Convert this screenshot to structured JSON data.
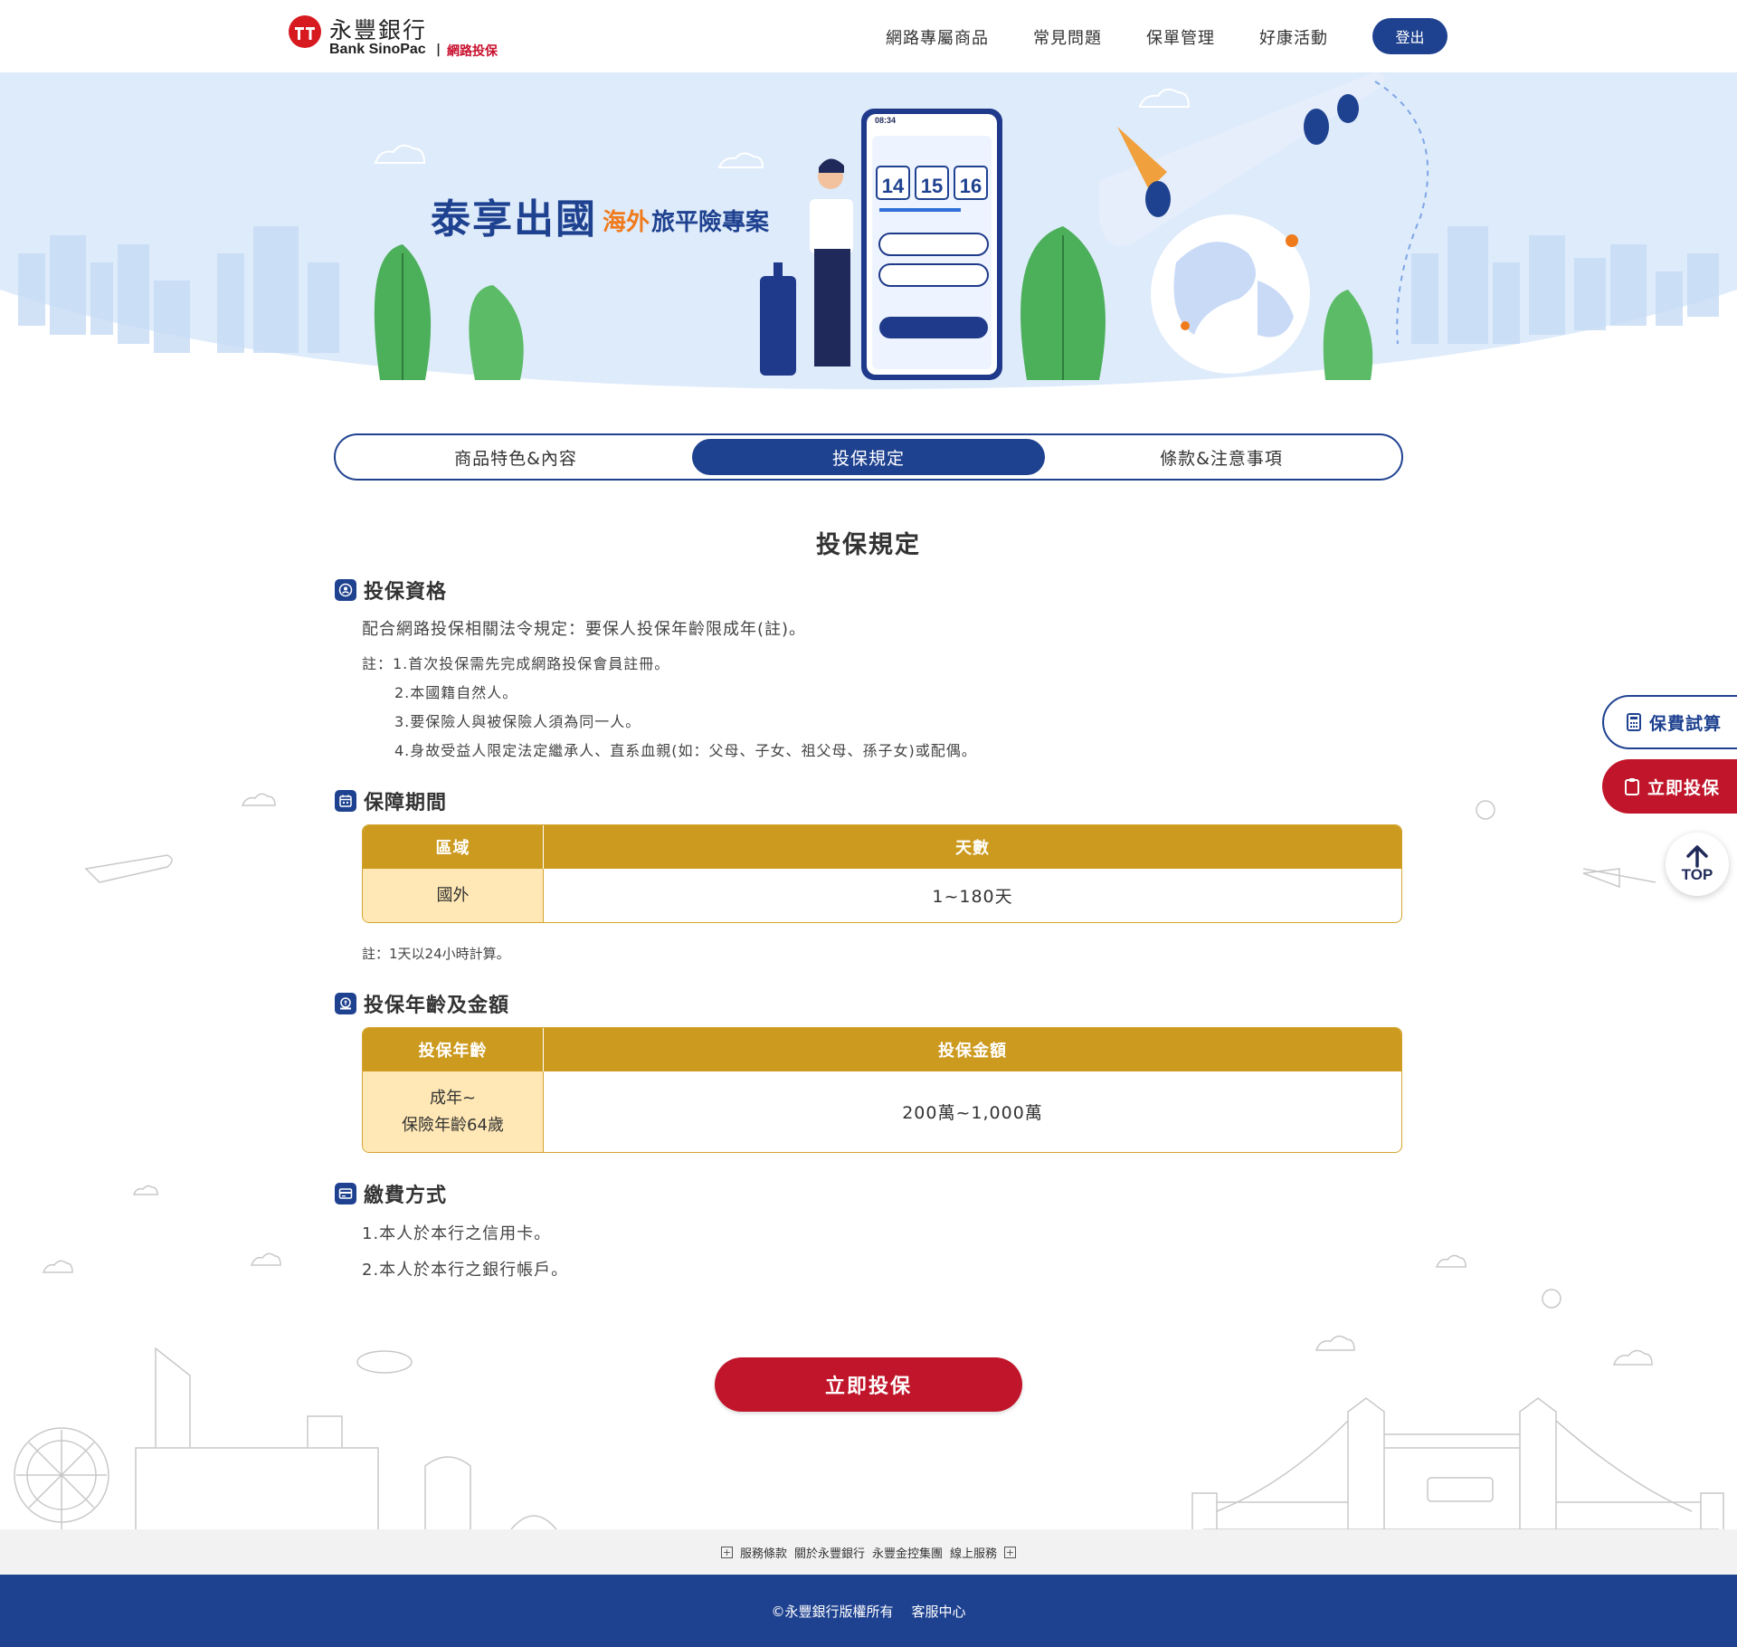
{
  "header": {
    "logo_cn": "永豐銀行",
    "logo_en": "Bank SinoPac",
    "logo_sep": "|",
    "logo_sub": "網路投保",
    "nav": [
      "網路專屬商品",
      "常見問題",
      "保單管理",
      "好康活動"
    ],
    "logout": "登出"
  },
  "hero": {
    "title": "泰享出國",
    "sub_a": "海外",
    "sub_b": "旅平險專案",
    "phone_time": "08:34",
    "calendar": [
      "14",
      "15",
      "16"
    ]
  },
  "tabs": [
    {
      "label": "商品特色&內容",
      "active": false
    },
    {
      "label": "投保規定",
      "active": true
    },
    {
      "label": "條款&注意事項",
      "active": false
    }
  ],
  "page_title": "投保規定",
  "eligibility": {
    "title": "投保資格",
    "icon": "person-icon",
    "main": "配合網路投保相關法令規定：要保人投保年齡限成年(註)。",
    "notes": [
      "註：1.首次投保需先完成網路投保會員註冊。",
      "2.本國籍自然人。",
      "3.要保險人與被保險人須為同一人。",
      "4.身故受益人限定法定繼承人、直系血親(如：父母、子女、祖父母、孫子女)或配偶。"
    ]
  },
  "period": {
    "title": "保障期間",
    "icon": "calendar-icon",
    "headers": [
      "區域",
      "天數"
    ],
    "rows": [
      [
        "國外",
        "1~180天"
      ]
    ],
    "note": "註：1天以24小時計算。"
  },
  "amount": {
    "title": "投保年齡及金額",
    "icon": "money-icon",
    "headers": [
      "投保年齡",
      "投保金額"
    ],
    "age_line1": "成年~",
    "age_line2": "保險年齡64歲",
    "value": "200萬~1,000萬"
  },
  "payment": {
    "title": "繳費方式",
    "icon": "card-icon",
    "items": [
      "1.本人於本行之信用卡。",
      "2.本人於本行之銀行帳戶。"
    ]
  },
  "cta": "立即投保",
  "side": {
    "calc": "保費試算",
    "apply": "立即投保",
    "top": "TOP"
  },
  "footer": {
    "links": [
      "服務條款",
      "關於永豐銀行",
      "永豐金控集團",
      "線上服務"
    ],
    "copyright": "©永豐銀行版權所有",
    "service": "客服中心"
  },
  "colors": {
    "brand_blue": "#1f4290",
    "brand_red": "#c0152a",
    "table_gold": "#cc9a1f",
    "table_cell": "#ffe8b5",
    "accent_orange": "#f07b1d"
  }
}
